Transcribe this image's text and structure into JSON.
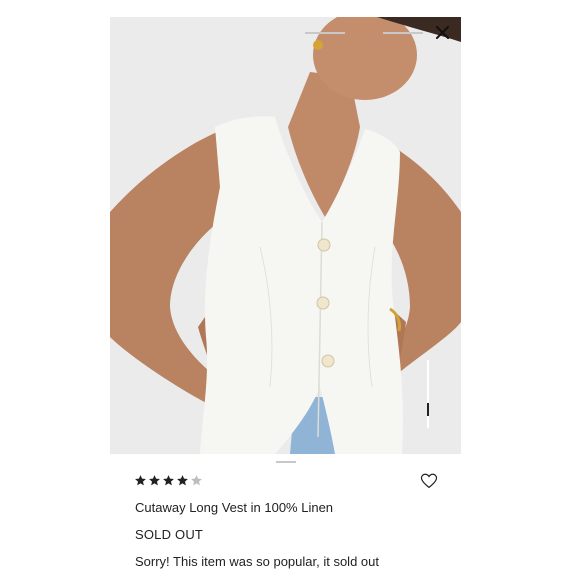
{
  "viewer": {
    "close_icon": "close-icon",
    "image_subject": "model wearing a white sleeveless linen vest with three round buttons, over light blue jeans"
  },
  "product": {
    "rating": 4,
    "rating_max": 5,
    "star_filled_color": "#222222",
    "star_empty_color": "#bdbdbd",
    "wishlist_icon": "heart-outline-icon",
    "title": "Cutaway Long Vest in 100% Linen",
    "status": "SOLD OUT",
    "status_message": "Sorry! This item was so popular, it sold out"
  }
}
